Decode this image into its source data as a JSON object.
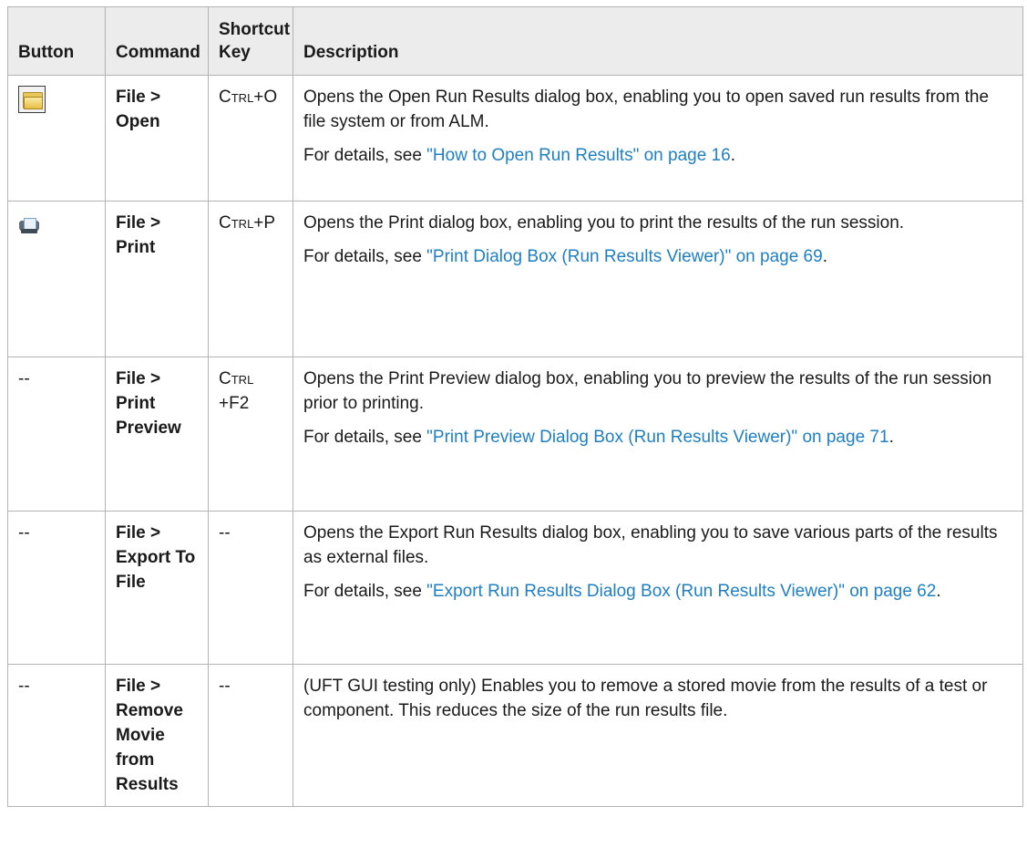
{
  "table": {
    "headers": {
      "button": "Button",
      "command": "Command",
      "shortcut": "Shortcut Key",
      "description": "Description"
    },
    "rows": [
      {
        "button_icon": "open-folder-icon",
        "button_text": "",
        "command": "File > Open",
        "key_prefix": "C",
        "key_smallcaps": "trl",
        "key_suffix": "+O",
        "desc_1": "Opens the Open Run Results dialog box, enabling you to open saved run results from the file system or from ALM.",
        "desc_2_prefix": "For details, see ",
        "desc_2_link": "\"How to Open Run Results\" on page 16",
        "desc_2_suffix": "."
      },
      {
        "button_icon": "printer-icon",
        "button_text": "",
        "command": "File > Print",
        "key_prefix": "C",
        "key_smallcaps": "trl",
        "key_suffix": "+P",
        "desc_1": "Opens the Print dialog box, enabling you to print the results of the run session.",
        "desc_2_prefix": "For details, see ",
        "desc_2_link": "\"Print Dialog Box (Run Results Viewer)\" on page 69",
        "desc_2_suffix": "."
      },
      {
        "button_icon": "",
        "button_text": "--",
        "command": "File > Print Preview",
        "key_prefix": "C",
        "key_smallcaps": "trl",
        "key_suffix": "+F2",
        "desc_1": "Opens the Print Preview dialog box, enabling you to preview the results of the run session prior to printing.",
        "desc_2_prefix": "For details, see ",
        "desc_2_link": "\"Print Preview Dialog Box (Run Results Viewer)\" on page 71",
        "desc_2_suffix": "."
      },
      {
        "button_icon": "",
        "button_text": "--",
        "command": "File > Export To File",
        "key_text": "--",
        "desc_1": "Opens the Export Run Results dialog box, enabling you to save various parts of the results as external files.",
        "desc_2_prefix": "For details, see ",
        "desc_2_link": "\"Export Run Results Dialog Box (Run Results Viewer)\" on page 62",
        "desc_2_suffix": "."
      },
      {
        "button_icon": "",
        "button_text": "--",
        "command": "File > Remove Movie from Results",
        "key_text": "--",
        "desc_1": "(UFT GUI testing only) Enables you to remove a stored movie from the results of a test or component. This reduces the size of the run results file."
      }
    ]
  }
}
